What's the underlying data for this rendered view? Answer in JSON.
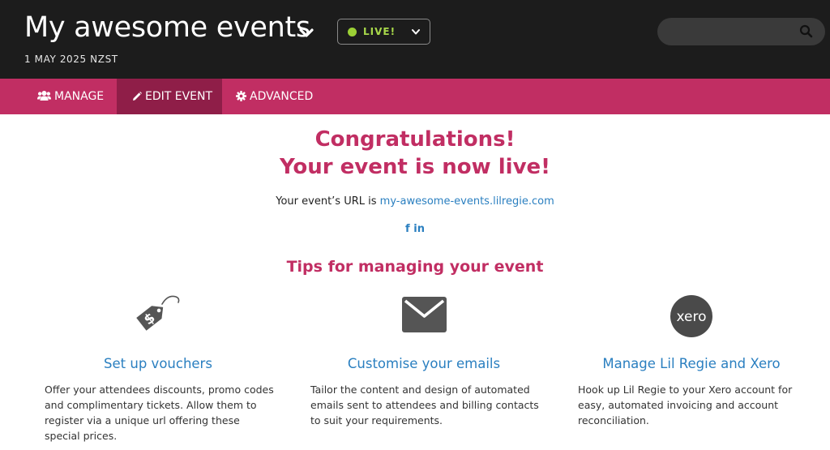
{
  "header": {
    "title": "My awesome events",
    "date": "1 MAY 2025 NZST",
    "status_label": "LIVE!",
    "status_color": "#9bd035",
    "search": {
      "placeholder": "",
      "value": "",
      "icon": "search-icon"
    }
  },
  "nav": {
    "tabs": [
      {
        "label": "MANAGE",
        "icon": "users-icon",
        "active": false
      },
      {
        "label": "EDIT EVENT",
        "icon": "pencil-icon",
        "active": true
      },
      {
        "label": "ADVANCED",
        "icon": "gear-icon",
        "active": false
      }
    ],
    "bar_color": "#c12e63",
    "active_color": "#8f1e48"
  },
  "main": {
    "headline_1": "Congratulations!",
    "headline_2": "Your event is now live!",
    "url_prefix": "Your event’s URL is",
    "url_link": "my-awesome-events.lilregie.com",
    "social": {
      "facebook": "f",
      "linkedin": "in"
    },
    "tips_title": "Tips for managing your event",
    "tips": [
      {
        "icon": "voucher-tag-icon",
        "title": "Set up vouchers",
        "description": "Offer your attendees discounts, promo codes and complimentary tickets. Allow them to register via a unique url offering these special prices."
      },
      {
        "icon": "envelope-icon",
        "title": "Customise your emails",
        "description": "Tailor the content and design of automated emails sent to attendees and billing contacts to suit your requirements."
      },
      {
        "icon": "xero-logo-icon",
        "logo_text": "xero",
        "title": "Manage Lil Regie and Xero",
        "description": "Hook up Lil Regie to your Xero account for easy, automated invoicing and account reconciliation."
      }
    ],
    "accent_color": "#c12e63",
    "link_color": "#2a7fc0"
  }
}
